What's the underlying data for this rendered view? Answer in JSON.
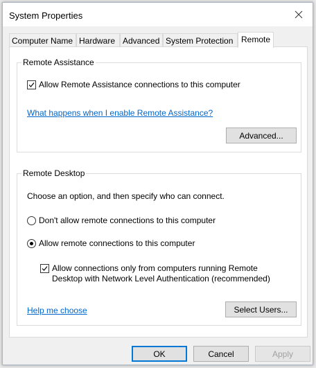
{
  "window": {
    "title": "System Properties"
  },
  "tabs": [
    {
      "label": "Computer Name",
      "active": false
    },
    {
      "label": "Hardware",
      "active": false
    },
    {
      "label": "Advanced",
      "active": false
    },
    {
      "label": "System Protection",
      "active": false
    },
    {
      "label": "Remote",
      "active": true
    }
  ],
  "remote_assistance": {
    "title": "Remote Assistance",
    "allow_label": "Allow Remote Assistance connections to this computer",
    "allow_checked": true,
    "help_link": "What happens when I enable Remote Assistance?",
    "advanced_button": "Advanced..."
  },
  "remote_desktop": {
    "title": "Remote Desktop",
    "instruction": "Choose an option, and then specify who can connect.",
    "options": [
      {
        "label": "Don't allow remote connections to this computer",
        "selected": false
      },
      {
        "label": "Allow remote connections to this computer",
        "selected": true
      }
    ],
    "nla_label_line1": "Allow connections only from computers running Remote",
    "nla_label_line2": "Desktop with Network Level Authentication (recommended)",
    "nla_checked": true,
    "help_link": "Help me choose",
    "select_users_button": "Select Users..."
  },
  "footer": {
    "ok": "OK",
    "cancel": "Cancel",
    "apply": "Apply",
    "apply_enabled": false
  },
  "colors": {
    "link": "#0066cc",
    "default_button_border": "#0078d7"
  }
}
